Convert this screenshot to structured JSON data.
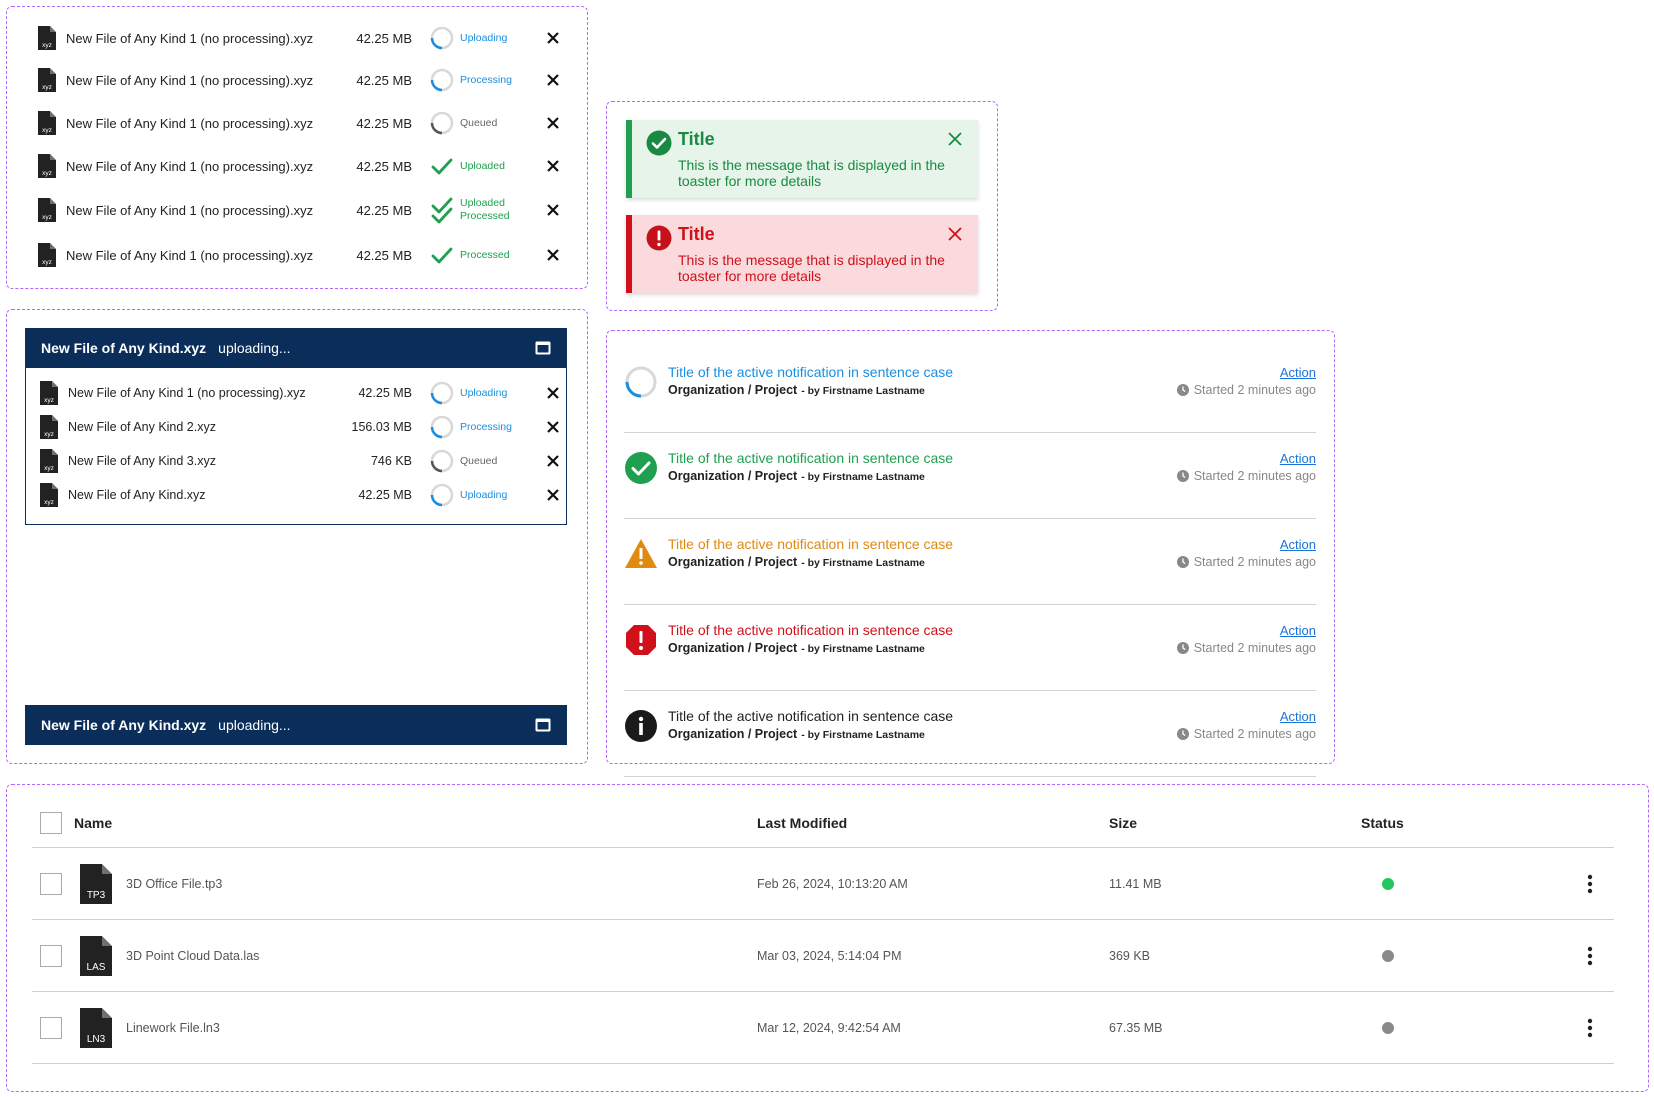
{
  "file_list": {
    "rows": [
      {
        "name": "New File of Any Kind 1 (no processing).xyz",
        "size": "42.25 MB",
        "status": "Uploading",
        "status_color": "#1a8fe0"
      },
      {
        "name": "New File of Any Kind 1 (no processing).xyz",
        "size": "42.25 MB",
        "status": "Processing",
        "status_color": "#1a8fe0"
      },
      {
        "name": "New File of Any Kind 1 (no processing).xyz",
        "size": "42.25 MB",
        "status": "Queued",
        "status_color": "#666666"
      },
      {
        "name": "New File of Any Kind 1 (no processing).xyz",
        "size": "42.25 MB",
        "status": "Uploaded",
        "status_color": "#1fa050"
      },
      {
        "name": "New File of Any Kind 1 (no processing).xyz",
        "size": "42.25 MB",
        "status": "Uploaded",
        "status2": "Processed",
        "status_color": "#1fa050"
      },
      {
        "name": "New File of Any Kind 1 (no processing).xyz",
        "size": "42.25 MB",
        "status": "Processed",
        "status_color": "#1fa050"
      }
    ],
    "file_icon_label": "XYZ"
  },
  "toasts": [
    {
      "type": "success",
      "title": "Title",
      "message": "This is the message that is displayed in the toaster for more details",
      "bg": "#e6f4ea",
      "accent": "#1fa050",
      "text_color": "#1a8a42"
    },
    {
      "type": "error",
      "title": "Title",
      "message": "This is the message that is displayed in the toaster for more details",
      "bg": "#fadadd",
      "accent": "#d0101b",
      "text_color": "#d0101b"
    }
  ],
  "uploader": {
    "header_title": "New File of Any Kind.xyz",
    "header_status": "uploading...",
    "rows": [
      {
        "name": "New File of Any Kind 1 (no processing).xyz",
        "size": "42.25 MB",
        "status": "Uploading"
      },
      {
        "name": "New File of Any Kind 2.xyz",
        "size": "156.03 MB",
        "status": "Processing"
      },
      {
        "name": "New File of Any Kind 3.xyz",
        "size": "746 KB",
        "status": "Queued"
      },
      {
        "name": "New File of Any Kind.xyz",
        "size": "42.25 MB",
        "status": "Uploading"
      }
    ],
    "collapsed_title": "New File of Any Kind.xyz",
    "collapsed_status": "uploading...",
    "header_bg": "#0b2d5a"
  },
  "notifications": [
    {
      "type": "active",
      "title": "Title of the active notification in sentence case",
      "org": "Organization / Project",
      "by": "- by Firstname Lastname",
      "action": "Action",
      "time": "Started 2 minutes ago",
      "title_color": "#1a8fe0"
    },
    {
      "type": "success",
      "title": "Title of the active notification in sentence case",
      "org": "Organization / Project",
      "by": "- by Firstname Lastname",
      "action": "Action",
      "time": "Started 2 minutes ago",
      "title_color": "#1fa050"
    },
    {
      "type": "warning",
      "title": "Title of the active notification in sentence case",
      "org": "Organization / Project",
      "by": "- by Firstname Lastname",
      "action": "Action",
      "time": "Started 2 minutes ago",
      "title_color": "#e08a10"
    },
    {
      "type": "error",
      "title": "Title of the active notification in sentence case",
      "org": "Organization / Project",
      "by": "- by Firstname Lastname",
      "action": "Action",
      "time": "Started 2 minutes ago",
      "title_color": "#d0101b"
    },
    {
      "type": "info",
      "title": "Title of the active notification in sentence case",
      "org": "Organization / Project",
      "by": "- by Firstname Lastname",
      "action": "Action",
      "time": "Started 2 minutes ago",
      "title_color": "#222222"
    }
  ],
  "table": {
    "headers": {
      "name": "Name",
      "modified": "Last Modified",
      "size": "Size",
      "status": "Status"
    },
    "rows": [
      {
        "icon": "TP3",
        "name": "3D Office File.tp3",
        "modified": "Feb 26, 2024, 10:13:20 AM",
        "size": "11.41 MB",
        "status_color": "#22c55e"
      },
      {
        "icon": "LAS",
        "name": "3D Point Cloud Data.las",
        "modified": "Mar 03, 2024, 5:14:04 PM",
        "size": "369 KB",
        "status_color": "#8a8a8a"
      },
      {
        "icon": "LN3",
        "name": "Linework File.ln3",
        "modified": "Mar 12, 2024, 9:42:54 AM",
        "size": "67.35 MB",
        "status_color": "#8a8a8a"
      }
    ]
  }
}
